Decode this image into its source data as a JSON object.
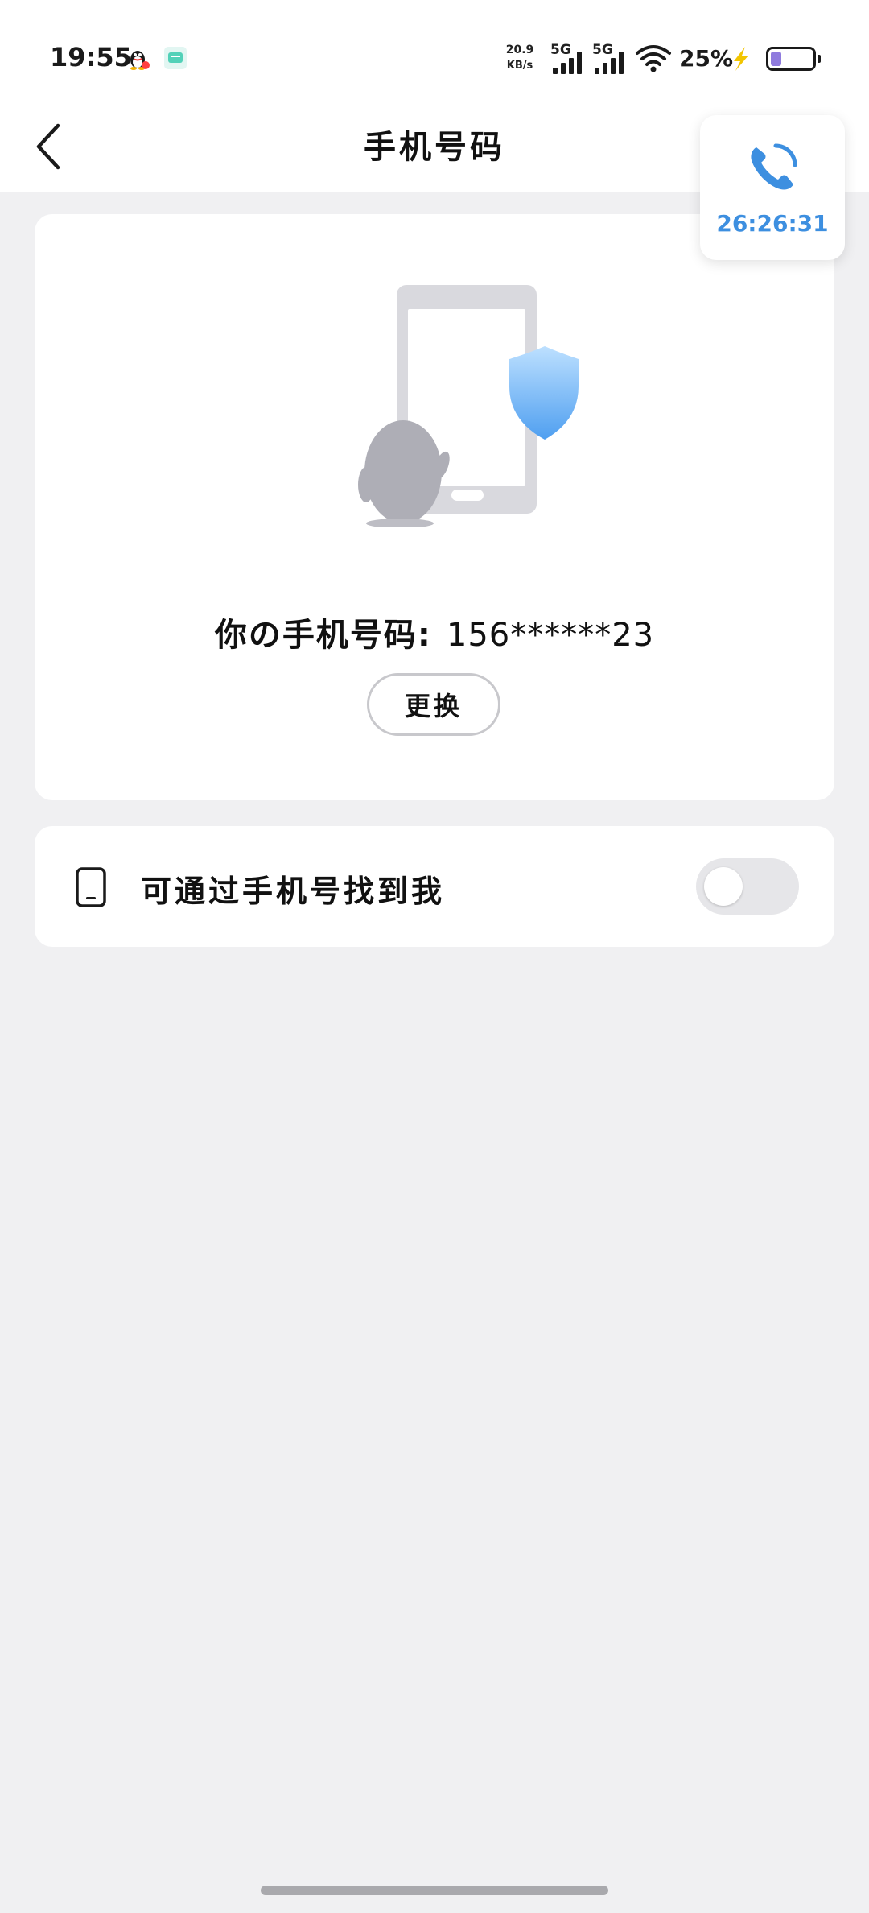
{
  "status_bar": {
    "time": "19:55",
    "net_speed_value": "20.9",
    "net_speed_unit": "KB/s",
    "signal_1_label": "5G",
    "signal_2_label": "5G",
    "battery_percent": "25%",
    "battery_level": 0.25,
    "charging": true
  },
  "header": {
    "title": "手机号码"
  },
  "call_widget": {
    "timer": "26:26:31",
    "accent_color": "#3d8fe0"
  },
  "phone_card": {
    "label": "你の手机号码:",
    "masked_number": "156******23",
    "change_button_label": "更换"
  },
  "find_setting": {
    "label": "可通过手机号找到我",
    "enabled": false
  },
  "colors": {
    "page_background": "#f0f0f2",
    "card_background": "#ffffff",
    "accent": "#3d8fe0"
  }
}
